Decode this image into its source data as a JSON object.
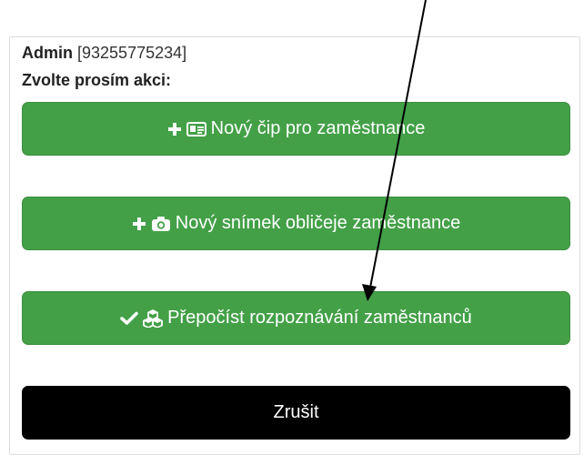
{
  "dialog": {
    "admin_name": "Admin",
    "admin_id": "[93255775234]",
    "prompt": "Zvolte prosím akci:"
  },
  "buttons": {
    "new_chip": "Nový čip pro zaměstnance",
    "new_face": "Nový snímek obličeje zaměstnance",
    "recalc": "Přepočíst rozpoznávání zaměstnanců",
    "cancel": "Zrušit"
  },
  "colors": {
    "button_green": "#43a047",
    "button_black": "#000000",
    "text_white": "#ffffff"
  },
  "icons": {
    "new_chip": [
      "plus-icon",
      "id-card-icon"
    ],
    "new_face": [
      "plus-icon",
      "camera-icon"
    ],
    "recalc": [
      "check-icon",
      "cubes-icon"
    ]
  }
}
